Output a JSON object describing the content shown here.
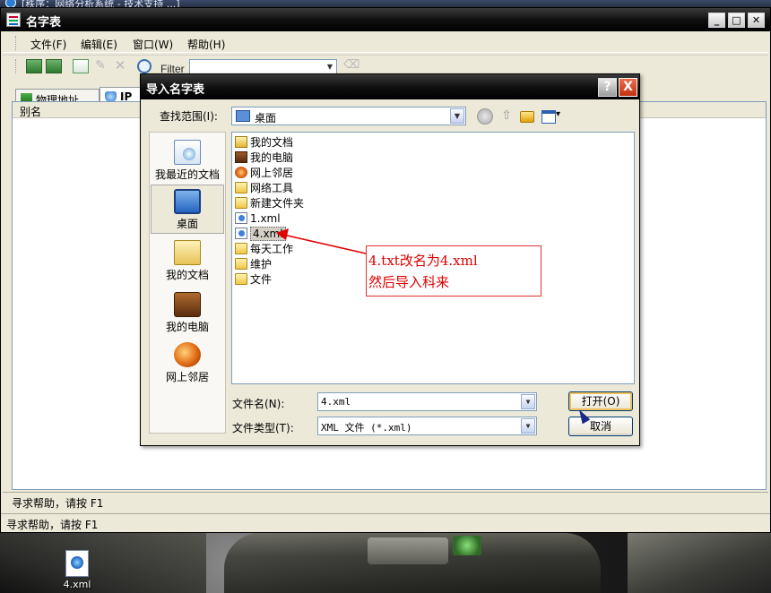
{
  "main_window": {
    "title": "名字表",
    "menus": [
      "文件(F)",
      "编辑(E)",
      "窗口(W)",
      "帮助(H)"
    ],
    "toolbar": {
      "filter_label": "Filter",
      "filter_value": ""
    },
    "tabs": [
      "物理地址",
      "IP地"
    ],
    "column_header": "别名",
    "inner_status": "寻求帮助，请按 F1",
    "outer_status": "寻求帮助，请按 F1"
  },
  "dialog": {
    "title": "导入名字表",
    "help_button": "?",
    "close_button": "X",
    "look_in_label": "查找范围(I):",
    "look_in_value": "桌面",
    "places": [
      "我最近的文档",
      "桌面",
      "我的文档",
      "我的电脑",
      "网上邻居"
    ],
    "files": [
      {
        "name": "我的文档",
        "icon": "my-documents-icon"
      },
      {
        "name": "我的电脑",
        "icon": "my-computer-icon"
      },
      {
        "name": "网上邻居",
        "icon": "network-icon"
      },
      {
        "name": "网络工具",
        "icon": "folder-icon"
      },
      {
        "name": "新建文件夹",
        "icon": "folder-icon"
      },
      {
        "name": "1.xml",
        "icon": "xml-file-icon"
      },
      {
        "name": "4.xml",
        "icon": "xml-file-icon",
        "selected": true
      },
      {
        "name": "每天工作",
        "icon": "folder-shortcut-icon"
      },
      {
        "name": "维护",
        "icon": "folder-shortcut-icon"
      },
      {
        "name": "文件",
        "icon": "folder-shortcut-icon"
      }
    ],
    "filename_label": "文件名(N):",
    "filename_value": "4.xml",
    "filetype_label": "文件类型(T):",
    "filetype_value": "XML 文件 (*.xml)",
    "open_button": "打开(O)",
    "cancel_button": "取消"
  },
  "annotation": {
    "line1": "4.txt改名为4.xml",
    "line2": "然后导入科来"
  },
  "desktop": {
    "icon_label": "4.xml"
  },
  "background_title": "[秩序：网络分析系统 - 技术支持 ...]",
  "colors": {
    "annotation_red": "#e00000",
    "titlebar": "#000000",
    "dialog_bg": "#ece9d8"
  }
}
